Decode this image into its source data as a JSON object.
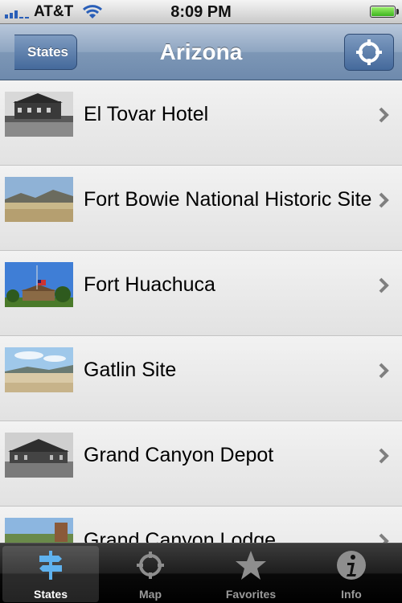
{
  "status_bar": {
    "carrier": "AT&T",
    "time": "8:09 PM"
  },
  "nav": {
    "back_label": "States",
    "title": "Arizona"
  },
  "list": {
    "items": [
      {
        "label": "El Tovar Hotel"
      },
      {
        "label": "Fort Bowie National Historic Site"
      },
      {
        "label": "Fort Huachuca"
      },
      {
        "label": "Gatlin Site"
      },
      {
        "label": "Grand Canyon Depot"
      },
      {
        "label": "Grand Canyon Lodge"
      }
    ]
  },
  "tab_bar": {
    "tabs": [
      {
        "label": "States",
        "icon": "signpost-icon",
        "active": true
      },
      {
        "label": "Map",
        "icon": "crosshair-icon",
        "active": false
      },
      {
        "label": "Favorites",
        "icon": "star-icon",
        "active": false
      },
      {
        "label": "Info",
        "icon": "info-icon",
        "active": false
      }
    ]
  },
  "colors": {
    "nav_blue": "#6e8aad",
    "accent_blue": "#4a9be0"
  }
}
